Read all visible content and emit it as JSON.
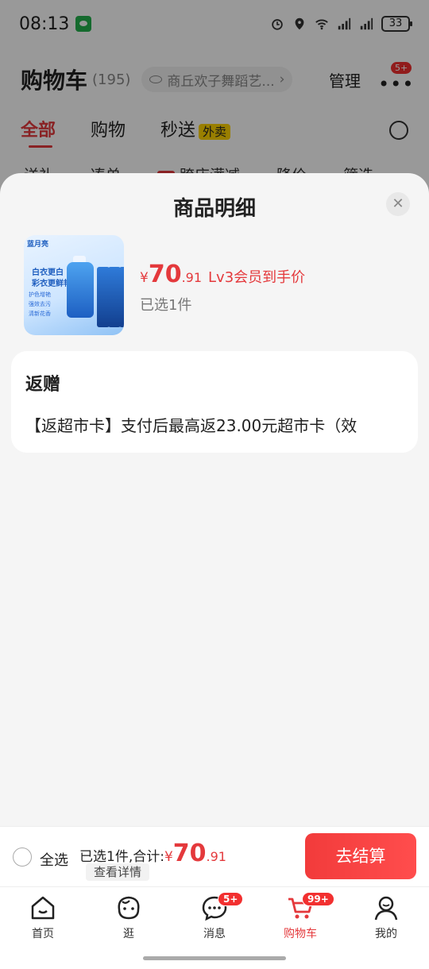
{
  "status_bar": {
    "time": "08:13",
    "battery": "33"
  },
  "cart": {
    "title": "购物车",
    "count": "(195)",
    "store_name": "商丘欢子舞蹈艺...",
    "manage_label": "管理",
    "more_badge": "5+",
    "tabs": [
      {
        "label": "全部"
      },
      {
        "label": "购物"
      },
      {
        "label": "秒送"
      }
    ],
    "waimai_tag": "外卖",
    "filters": [
      "送礼",
      "凑单",
      "跨店满减",
      "降价",
      "筛选"
    ]
  },
  "sheet": {
    "title": "商品明细",
    "close_icon": "close-icon",
    "product": {
      "thumb_brand": "蓝月亮",
      "thumb_line1": "白衣更白",
      "thumb_line2": "彩衣更鲜艳",
      "thumb_feat1": "护色增艳",
      "thumb_feat2": "强效去污",
      "thumb_feat3": "清新花香",
      "price_yen": "¥",
      "price_int": "70",
      "price_dec": ".91",
      "price_label": "Lv3会员到手价",
      "selected_count": "已选1件"
    },
    "gift": {
      "title": "返赠",
      "text": "【返超市卡】支付后最高返23.00元超市卡（效"
    }
  },
  "checkout": {
    "select_all": "全选",
    "summary_text": "已选1件,合计:",
    "total_yen": "¥",
    "total_int": "70",
    "total_dec": ".91",
    "details_label": "查看详情",
    "checkout_label": "去结算"
  },
  "nav": {
    "items": [
      {
        "label": "首页",
        "icon": "home-icon"
      },
      {
        "label": "逛",
        "icon": "face-icon"
      },
      {
        "label": "消息",
        "icon": "message-icon",
        "badge": "5+"
      },
      {
        "label": "购物车",
        "icon": "cart-icon",
        "badge": "99+"
      },
      {
        "label": "我的",
        "icon": "person-icon"
      }
    ]
  },
  "colors": {
    "accent": "#e4393c",
    "waimai": "#ffd400"
  }
}
